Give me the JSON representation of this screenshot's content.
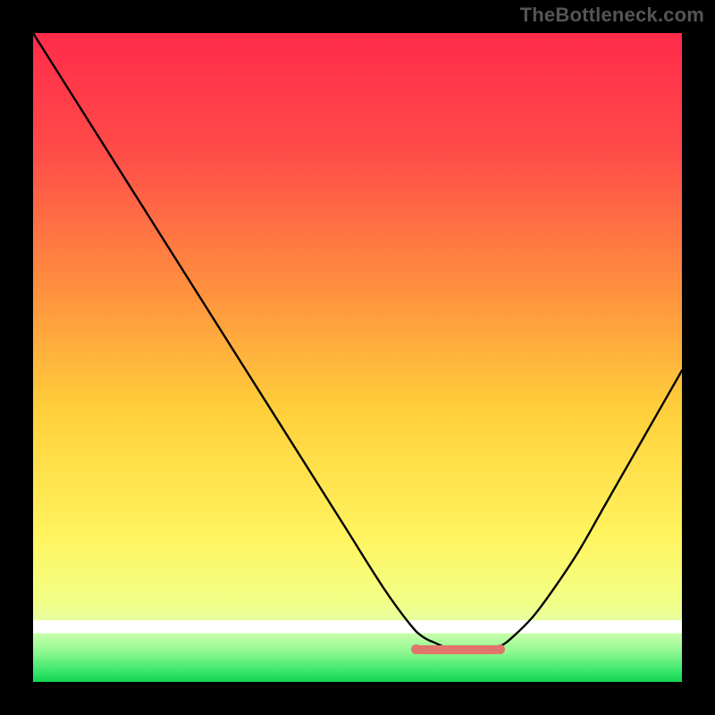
{
  "header": {
    "watermark": "TheBottleneck.com"
  },
  "colors": {
    "frame": "#000000",
    "gradient_top": "#ff2b4a",
    "gradient_mid_upper": "#ff6a4a",
    "gradient_mid": "#ffd23f",
    "gradient_lower": "#f7ff6a",
    "gradient_band_light": "#dcffb0",
    "gradient_bottom": "#1fe05a",
    "curve": "#000000",
    "marker": "#e0756b"
  },
  "plot": {
    "x_range": [
      0,
      100
    ],
    "y_range": [
      0,
      100
    ],
    "sweet_spot": {
      "start_x": 59,
      "end_x": 72,
      "y": 5
    }
  },
  "chart_data": {
    "type": "line",
    "title": "",
    "xlabel": "",
    "ylabel": "",
    "xlim": [
      0,
      100
    ],
    "ylim": [
      0,
      100
    ],
    "series": [
      {
        "name": "left-curve",
        "x": [
          0,
          6,
          12,
          18,
          24,
          30,
          36,
          42,
          48,
          54,
          58,
          60,
          62,
          64,
          66,
          68
        ],
        "y": [
          100,
          90.5,
          81,
          71.5,
          62,
          52.5,
          43,
          33.5,
          24,
          14.5,
          9,
          7,
          6,
          5.2,
          5,
          5
        ]
      },
      {
        "name": "right-curve",
        "x": [
          68,
          70,
          72,
          74,
          77,
          80,
          84,
          88,
          92,
          96,
          100
        ],
        "y": [
          5,
          5,
          5.5,
          7,
          10,
          14,
          20,
          27,
          34,
          41,
          48
        ]
      },
      {
        "name": "optimal-band",
        "x": [
          59,
          72
        ],
        "y": [
          5,
          5
        ]
      }
    ],
    "annotations": []
  }
}
